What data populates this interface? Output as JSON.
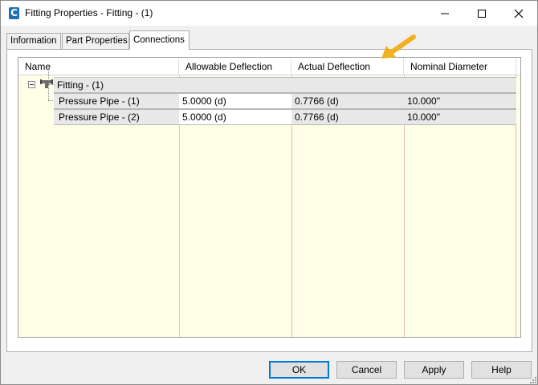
{
  "window": {
    "title": "Fitting Properties - Fitting - (1)",
    "app_icon_letter": "C",
    "accent": "#0078d7"
  },
  "tabs": [
    {
      "label": "Information",
      "active": false
    },
    {
      "label": "Part Properties",
      "active": false
    },
    {
      "label": "Connections",
      "active": true
    }
  ],
  "grid": {
    "columns": [
      "Name",
      "Allowable Deflection",
      "Actual Deflection",
      "Nominal Diameter"
    ],
    "root": {
      "name": "Fitting - (1)",
      "icon": "fitting-icon"
    },
    "rows": [
      {
        "name": "Pressure Pipe - (1)",
        "allowable": "5.0000 (d)",
        "actual": "0.7766 (d)",
        "nominal": "10.000\""
      },
      {
        "name": "Pressure Pipe - (2)",
        "allowable": "5.0000 (d)",
        "actual": "0.7766 (d)",
        "nominal": "10.000\""
      }
    ],
    "background": "#ffffe8"
  },
  "annotation": {
    "icon": "arrow-icon",
    "color": "#f0b020"
  },
  "buttons": {
    "ok": "OK",
    "cancel": "Cancel",
    "apply": "Apply",
    "help": "Help"
  }
}
